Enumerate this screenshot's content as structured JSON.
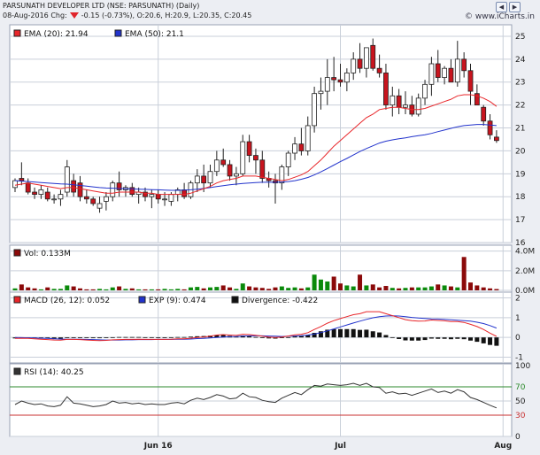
{
  "header": {
    "title": "PARSUNATH DEVELOPER LTD (NSE: PARSUNATH) (Daily)",
    "date": "08-Aug-2016",
    "chg_label": "Chg:",
    "quote": "-0.15 (-0.73%), O:20.6, H:20.9, L:20.35, C:20.45",
    "watermark": "© www.iCharts.in",
    "controls": [
      "◀",
      "▶"
    ]
  },
  "legends": {
    "ema20": "EMA (20): 21.94",
    "ema50": "EMA (50): 21.1",
    "vol": "Vol: 0.133M",
    "macd": "MACD (26, 12): 0.052",
    "exp": "EXP (9): 0.474",
    "div": "Divergence: -0.422",
    "rsi": "RSI (14): 40.25"
  },
  "colors": {
    "up": "#ffffff",
    "down": "#c8141e",
    "ema20": "#e8262a",
    "ema50": "#2233cc",
    "grid": "#c9cfd9",
    "vol_up": "#0b8a0b",
    "vol_down": "#8b0a0a",
    "rsi_70": "#2c8a2c",
    "rsi_30": "#c83030"
  },
  "chart_data": [
    {
      "type": "candlestick",
      "panel": "price",
      "ylim": [
        16,
        25.5
      ],
      "yticks": [
        16,
        17,
        18,
        19,
        20,
        21,
        22,
        23,
        24,
        25
      ],
      "xticks": [
        {
          "i": 22,
          "label": "Jun 16"
        },
        {
          "i": 50,
          "label": "Jul"
        },
        {
          "i": 75,
          "label": "Aug"
        }
      ],
      "ohlc": [
        [
          18.4,
          18.8,
          18.2,
          18.7
        ],
        [
          18.8,
          19.5,
          18.5,
          18.7
        ],
        [
          18.6,
          18.8,
          18.1,
          18.2
        ],
        [
          18.2,
          18.4,
          17.9,
          18.1
        ],
        [
          18.1,
          18.5,
          17.9,
          18.3
        ],
        [
          18.2,
          18.4,
          17.8,
          17.9
        ],
        [
          17.9,
          18.1,
          17.7,
          17.9
        ],
        [
          17.9,
          18.3,
          17.6,
          18.1
        ],
        [
          18.2,
          19.6,
          18.0,
          19.3
        ],
        [
          18.7,
          19.0,
          18.0,
          18.2
        ],
        [
          18.6,
          18.9,
          17.8,
          18.0
        ],
        [
          18.0,
          18.3,
          17.7,
          17.9
        ],
        [
          17.9,
          18.0,
          17.6,
          17.7
        ],
        [
          17.5,
          18.0,
          17.3,
          17.7
        ],
        [
          17.8,
          18.2,
          17.4,
          18.0
        ],
        [
          18.0,
          18.7,
          17.8,
          18.6
        ],
        [
          18.6,
          19.1,
          18.0,
          18.3
        ],
        [
          18.3,
          18.5,
          18.0,
          18.4
        ],
        [
          18.4,
          18.6,
          18.0,
          18.1
        ],
        [
          18.1,
          18.4,
          17.7,
          18.2
        ],
        [
          18.2,
          18.4,
          17.8,
          18.0
        ],
        [
          18.0,
          18.3,
          17.5,
          18.1
        ],
        [
          18.1,
          18.3,
          17.7,
          17.9
        ],
        [
          17.9,
          18.2,
          17.6,
          17.9
        ],
        [
          17.8,
          18.2,
          17.6,
          18.1
        ],
        [
          18.1,
          18.4,
          17.8,
          18.3
        ],
        [
          18.3,
          18.6,
          17.9,
          18.0
        ],
        [
          18.0,
          18.7,
          17.9,
          18.6
        ],
        [
          18.6,
          19.2,
          18.2,
          18.9
        ],
        [
          18.9,
          19.4,
          18.2,
          18.6
        ],
        [
          18.6,
          19.4,
          18.4,
          19.1
        ],
        [
          19.1,
          20.0,
          18.9,
          19.6
        ],
        [
          19.6,
          20.1,
          19.3,
          19.4
        ],
        [
          19.4,
          19.6,
          18.7,
          18.9
        ],
        [
          18.9,
          19.3,
          18.5,
          19.0
        ],
        [
          19.0,
          20.7,
          18.9,
          20.4
        ],
        [
          20.4,
          20.7,
          19.5,
          19.8
        ],
        [
          19.8,
          20.1,
          19.0,
          19.6
        ],
        [
          19.6,
          20.0,
          18.6,
          18.8
        ],
        [
          18.8,
          19.1,
          18.4,
          18.7
        ],
        [
          18.7,
          19.0,
          17.7,
          18.6
        ],
        [
          18.6,
          19.4,
          18.3,
          19.3
        ],
        [
          19.3,
          20.0,
          18.9,
          19.9
        ],
        [
          19.9,
          20.6,
          19.6,
          20.3
        ],
        [
          20.3,
          21.0,
          19.8,
          20.0
        ],
        [
          20.0,
          21.5,
          19.8,
          21.1
        ],
        [
          21.1,
          22.8,
          20.8,
          22.5
        ],
        [
          22.5,
          23.2,
          21.8,
          22.6
        ],
        [
          22.6,
          24.0,
          22.0,
          23.2
        ],
        [
          23.2,
          24.1,
          22.6,
          23.1
        ],
        [
          23.1,
          23.8,
          22.8,
          23.0
        ],
        [
          23.0,
          23.6,
          22.6,
          23.4
        ],
        [
          23.4,
          24.3,
          23.1,
          24.0
        ],
        [
          24.0,
          24.7,
          23.4,
          23.6
        ],
        [
          23.6,
          24.5,
          23.2,
          24.5
        ],
        [
          24.6,
          24.9,
          23.5,
          23.6
        ],
        [
          23.6,
          24.2,
          23.2,
          23.4
        ],
        [
          23.4,
          23.8,
          21.8,
          22.0
        ],
        [
          22.0,
          22.8,
          21.5,
          22.4
        ],
        [
          22.4,
          22.7,
          21.6,
          21.9
        ],
        [
          21.9,
          22.6,
          21.6,
          22.0
        ],
        [
          22.0,
          22.4,
          21.5,
          21.6
        ],
        [
          21.6,
          22.5,
          21.5,
          22.3
        ],
        [
          22.3,
          23.1,
          22.0,
          22.9
        ],
        [
          22.9,
          24.1,
          22.4,
          23.8
        ],
        [
          23.8,
          24.4,
          23.0,
          23.2
        ],
        [
          23.2,
          23.7,
          22.9,
          23.6
        ],
        [
          23.6,
          24.0,
          23.0,
          23.0
        ],
        [
          23.0,
          24.8,
          22.8,
          24.0
        ],
        [
          24.0,
          24.3,
          23.2,
          23.5
        ],
        [
          23.5,
          23.8,
          22.0,
          22.6
        ],
        [
          22.5,
          22.9,
          22.0,
          22.0
        ],
        [
          21.9,
          22.0,
          21.1,
          21.3
        ],
        [
          21.3,
          21.6,
          20.5,
          20.7
        ],
        [
          20.6,
          20.9,
          20.35,
          20.45
        ]
      ],
      "ema20": [
        18.5,
        18.55,
        18.6,
        18.55,
        18.5,
        18.45,
        18.4,
        18.35,
        18.4,
        18.4,
        18.35,
        18.3,
        18.25,
        18.2,
        18.15,
        18.15,
        18.2,
        18.2,
        18.2,
        18.2,
        18.15,
        18.15,
        18.1,
        18.1,
        18.1,
        18.1,
        18.1,
        18.15,
        18.25,
        18.35,
        18.45,
        18.6,
        18.7,
        18.75,
        18.8,
        18.9,
        18.9,
        18.9,
        18.85,
        18.8,
        18.75,
        18.7,
        18.75,
        18.85,
        18.95,
        19.1,
        19.35,
        19.6,
        19.9,
        20.2,
        20.45,
        20.7,
        20.95,
        21.2,
        21.45,
        21.6,
        21.8,
        21.85,
        21.9,
        21.9,
        21.85,
        21.8,
        21.8,
        21.85,
        21.95,
        22.05,
        22.15,
        22.25,
        22.4,
        22.45,
        22.45,
        22.4,
        22.3,
        22.15,
        21.94
      ],
      "ema50": [
        18.7,
        18.68,
        18.66,
        18.64,
        18.62,
        18.6,
        18.58,
        18.56,
        18.55,
        18.52,
        18.49,
        18.46,
        18.43,
        18.4,
        18.38,
        18.37,
        18.36,
        18.35,
        18.34,
        18.33,
        18.32,
        18.31,
        18.3,
        18.29,
        18.28,
        18.28,
        18.29,
        18.3,
        18.33,
        18.36,
        18.4,
        18.44,
        18.48,
        18.52,
        18.55,
        18.58,
        18.6,
        18.62,
        18.63,
        18.63,
        18.63,
        18.64,
        18.66,
        18.7,
        18.76,
        18.84,
        18.95,
        19.08,
        19.23,
        19.38,
        19.53,
        19.67,
        19.82,
        19.97,
        20.1,
        20.22,
        20.34,
        20.42,
        20.48,
        20.53,
        20.57,
        20.62,
        20.66,
        20.7,
        20.76,
        20.84,
        20.91,
        20.98,
        21.05,
        21.1,
        21.13,
        21.15,
        21.15,
        21.13,
        21.1
      ]
    },
    {
      "type": "bar",
      "panel": "volume",
      "ylim": [
        0,
        4.6
      ],
      "yticks": [
        {
          "v": 0,
          "label": "0.0M"
        },
        {
          "v": 2,
          "label": "2.0M"
        },
        {
          "v": 4,
          "label": "4.0M"
        }
      ],
      "values": [
        0.2,
        0.6,
        0.3,
        0.2,
        0.1,
        0.3,
        0.15,
        0.15,
        0.5,
        0.4,
        0.2,
        0.1,
        0.1,
        0.15,
        0.1,
        0.3,
        0.4,
        0.15,
        0.2,
        0.1,
        0.1,
        0.1,
        0.1,
        0.15,
        0.1,
        0.15,
        0.1,
        0.3,
        0.35,
        0.2,
        0.3,
        0.35,
        0.5,
        0.3,
        0.15,
        0.7,
        0.4,
        0.3,
        0.25,
        0.15,
        0.3,
        0.4,
        0.25,
        0.3,
        0.2,
        0.3,
        1.6,
        1.1,
        0.9,
        1.4,
        0.7,
        0.5,
        0.4,
        1.6,
        0.5,
        0.6,
        0.3,
        0.45,
        0.25,
        0.2,
        0.25,
        0.3,
        0.3,
        0.3,
        0.4,
        0.6,
        0.5,
        0.4,
        0.3,
        3.4,
        0.8,
        0.5,
        0.3,
        0.2,
        0.133
      ]
    },
    {
      "type": "line",
      "panel": "macd",
      "ylim": [
        -1.2,
        2.2
      ],
      "yticks": [
        -1,
        0,
        1,
        2
      ],
      "series": [
        {
          "name": "MACD (26, 12)",
          "values": [
            -0.05,
            -0.04,
            -0.05,
            -0.07,
            -0.09,
            -0.11,
            -0.13,
            -0.14,
            -0.1,
            -0.1,
            -0.11,
            -0.13,
            -0.15,
            -0.16,
            -0.15,
            -0.12,
            -0.11,
            -0.1,
            -0.1,
            -0.09,
            -0.1,
            -0.1,
            -0.1,
            -0.1,
            -0.09,
            -0.07,
            -0.07,
            -0.04,
            0.0,
            0.02,
            0.06,
            0.12,
            0.14,
            0.12,
            0.1,
            0.16,
            0.14,
            0.11,
            0.06,
            0.02,
            0.0,
            0.02,
            0.07,
            0.13,
            0.16,
            0.24,
            0.4,
            0.55,
            0.72,
            0.85,
            0.95,
            1.05,
            1.15,
            1.2,
            1.3,
            1.3,
            1.3,
            1.2,
            1.1,
            1.0,
            0.9,
            0.85,
            0.82,
            0.83,
            0.88,
            0.86,
            0.84,
            0.8,
            0.8,
            0.76,
            0.66,
            0.55,
            0.4,
            0.22,
            0.052
          ]
        },
        {
          "name": "EXP (9)",
          "values": [
            0.0,
            -0.01,
            -0.02,
            -0.03,
            -0.04,
            -0.05,
            -0.07,
            -0.08,
            -0.09,
            -0.09,
            -0.09,
            -0.1,
            -0.11,
            -0.12,
            -0.13,
            -0.13,
            -0.13,
            -0.12,
            -0.12,
            -0.11,
            -0.11,
            -0.11,
            -0.1,
            -0.1,
            -0.1,
            -0.09,
            -0.09,
            -0.08,
            -0.06,
            -0.05,
            -0.03,
            0.0,
            0.02,
            0.04,
            0.05,
            0.07,
            0.08,
            0.09,
            0.08,
            0.07,
            0.06,
            0.05,
            0.06,
            0.07,
            0.09,
            0.12,
            0.17,
            0.24,
            0.33,
            0.43,
            0.53,
            0.63,
            0.73,
            0.82,
            0.91,
            0.99,
            1.05,
            1.08,
            1.09,
            1.08,
            1.05,
            1.01,
            0.98,
            0.96,
            0.94,
            0.93,
            0.91,
            0.89,
            0.87,
            0.85,
            0.82,
            0.77,
            0.7,
            0.6,
            0.474
          ]
        }
      ],
      "divergence": [
        -0.05,
        -0.03,
        -0.03,
        -0.04,
        -0.05,
        -0.06,
        -0.06,
        -0.06,
        -0.01,
        -0.01,
        -0.02,
        -0.03,
        -0.04,
        -0.04,
        -0.02,
        0.01,
        0.02,
        0.02,
        0.02,
        0.02,
        0.01,
        0.01,
        0.0,
        0.0,
        0.01,
        0.02,
        0.02,
        0.04,
        0.06,
        0.07,
        0.09,
        0.12,
        0.12,
        0.08,
        0.05,
        0.09,
        0.06,
        0.02,
        -0.02,
        -0.05,
        -0.06,
        -0.03,
        0.01,
        0.06,
        0.07,
        0.12,
        0.23,
        0.31,
        0.39,
        0.42,
        0.42,
        0.42,
        0.42,
        0.38,
        0.39,
        0.31,
        0.25,
        0.12,
        0.01,
        -0.08,
        -0.15,
        -0.16,
        -0.16,
        -0.13,
        -0.06,
        -0.07,
        -0.07,
        -0.09,
        -0.07,
        -0.09,
        -0.16,
        -0.22,
        -0.3,
        -0.38,
        -0.422
      ]
    },
    {
      "type": "line",
      "panel": "rsi",
      "ylim": [
        0,
        100
      ],
      "yticks": [
        0,
        30,
        50,
        70,
        100
      ],
      "values": [
        45,
        50,
        47,
        45,
        46,
        43,
        42,
        44,
        56,
        47,
        46,
        44,
        42,
        43,
        45,
        50,
        47,
        48,
        46,
        47,
        45,
        46,
        45,
        45,
        47,
        48,
        46,
        51,
        54,
        52,
        55,
        59,
        57,
        53,
        54,
        61,
        56,
        55,
        51,
        49,
        48,
        54,
        58,
        62,
        59,
        66,
        72,
        71,
        74,
        73,
        72,
        73,
        75,
        72,
        75,
        70,
        69,
        61,
        63,
        60,
        61,
        58,
        61,
        64,
        67,
        62,
        64,
        61,
        66,
        63,
        55,
        52,
        48,
        44,
        40.25
      ]
    }
  ]
}
